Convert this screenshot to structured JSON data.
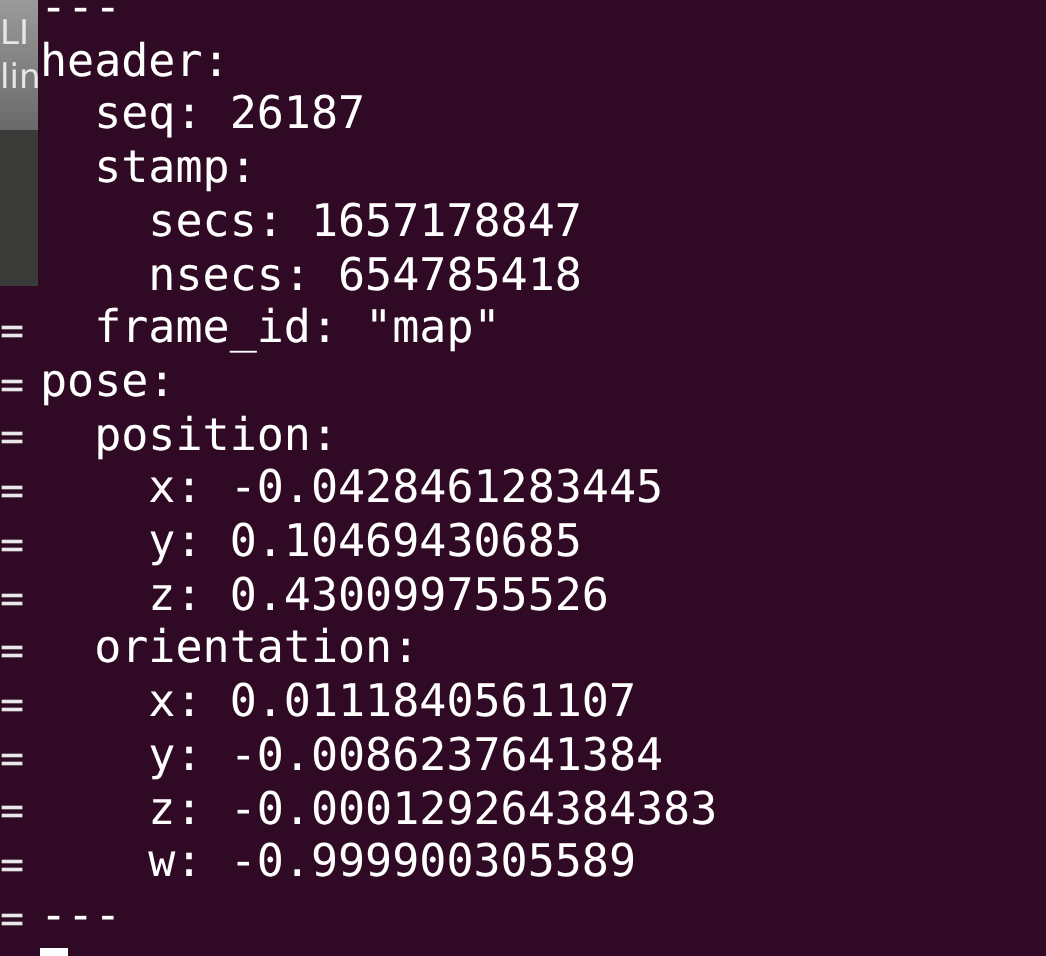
{
  "background_window": {
    "texts": [
      "LI",
      "lin"
    ],
    "marks": [
      "=",
      "=",
      "=",
      "=",
      "=",
      "=",
      "=",
      "=",
      "=",
      "=",
      "=",
      "="
    ]
  },
  "terminal": {
    "lines": [
      "---",
      "header:",
      "  seq: 26187",
      "  stamp:",
      "    secs: 1657178847",
      "    nsecs: 654785418",
      "  frame_id: \"map\"",
      "pose:",
      "  position:",
      "    x: -0.0428461283445",
      "    y: 0.10469430685",
      "    z: 0.430099755526",
      "  orientation:",
      "    x: 0.0111840561107",
      "    y: -0.0086237641384",
      "    z: -0.000129264384383",
      "    w: -0.999900305589",
      "---"
    ]
  }
}
